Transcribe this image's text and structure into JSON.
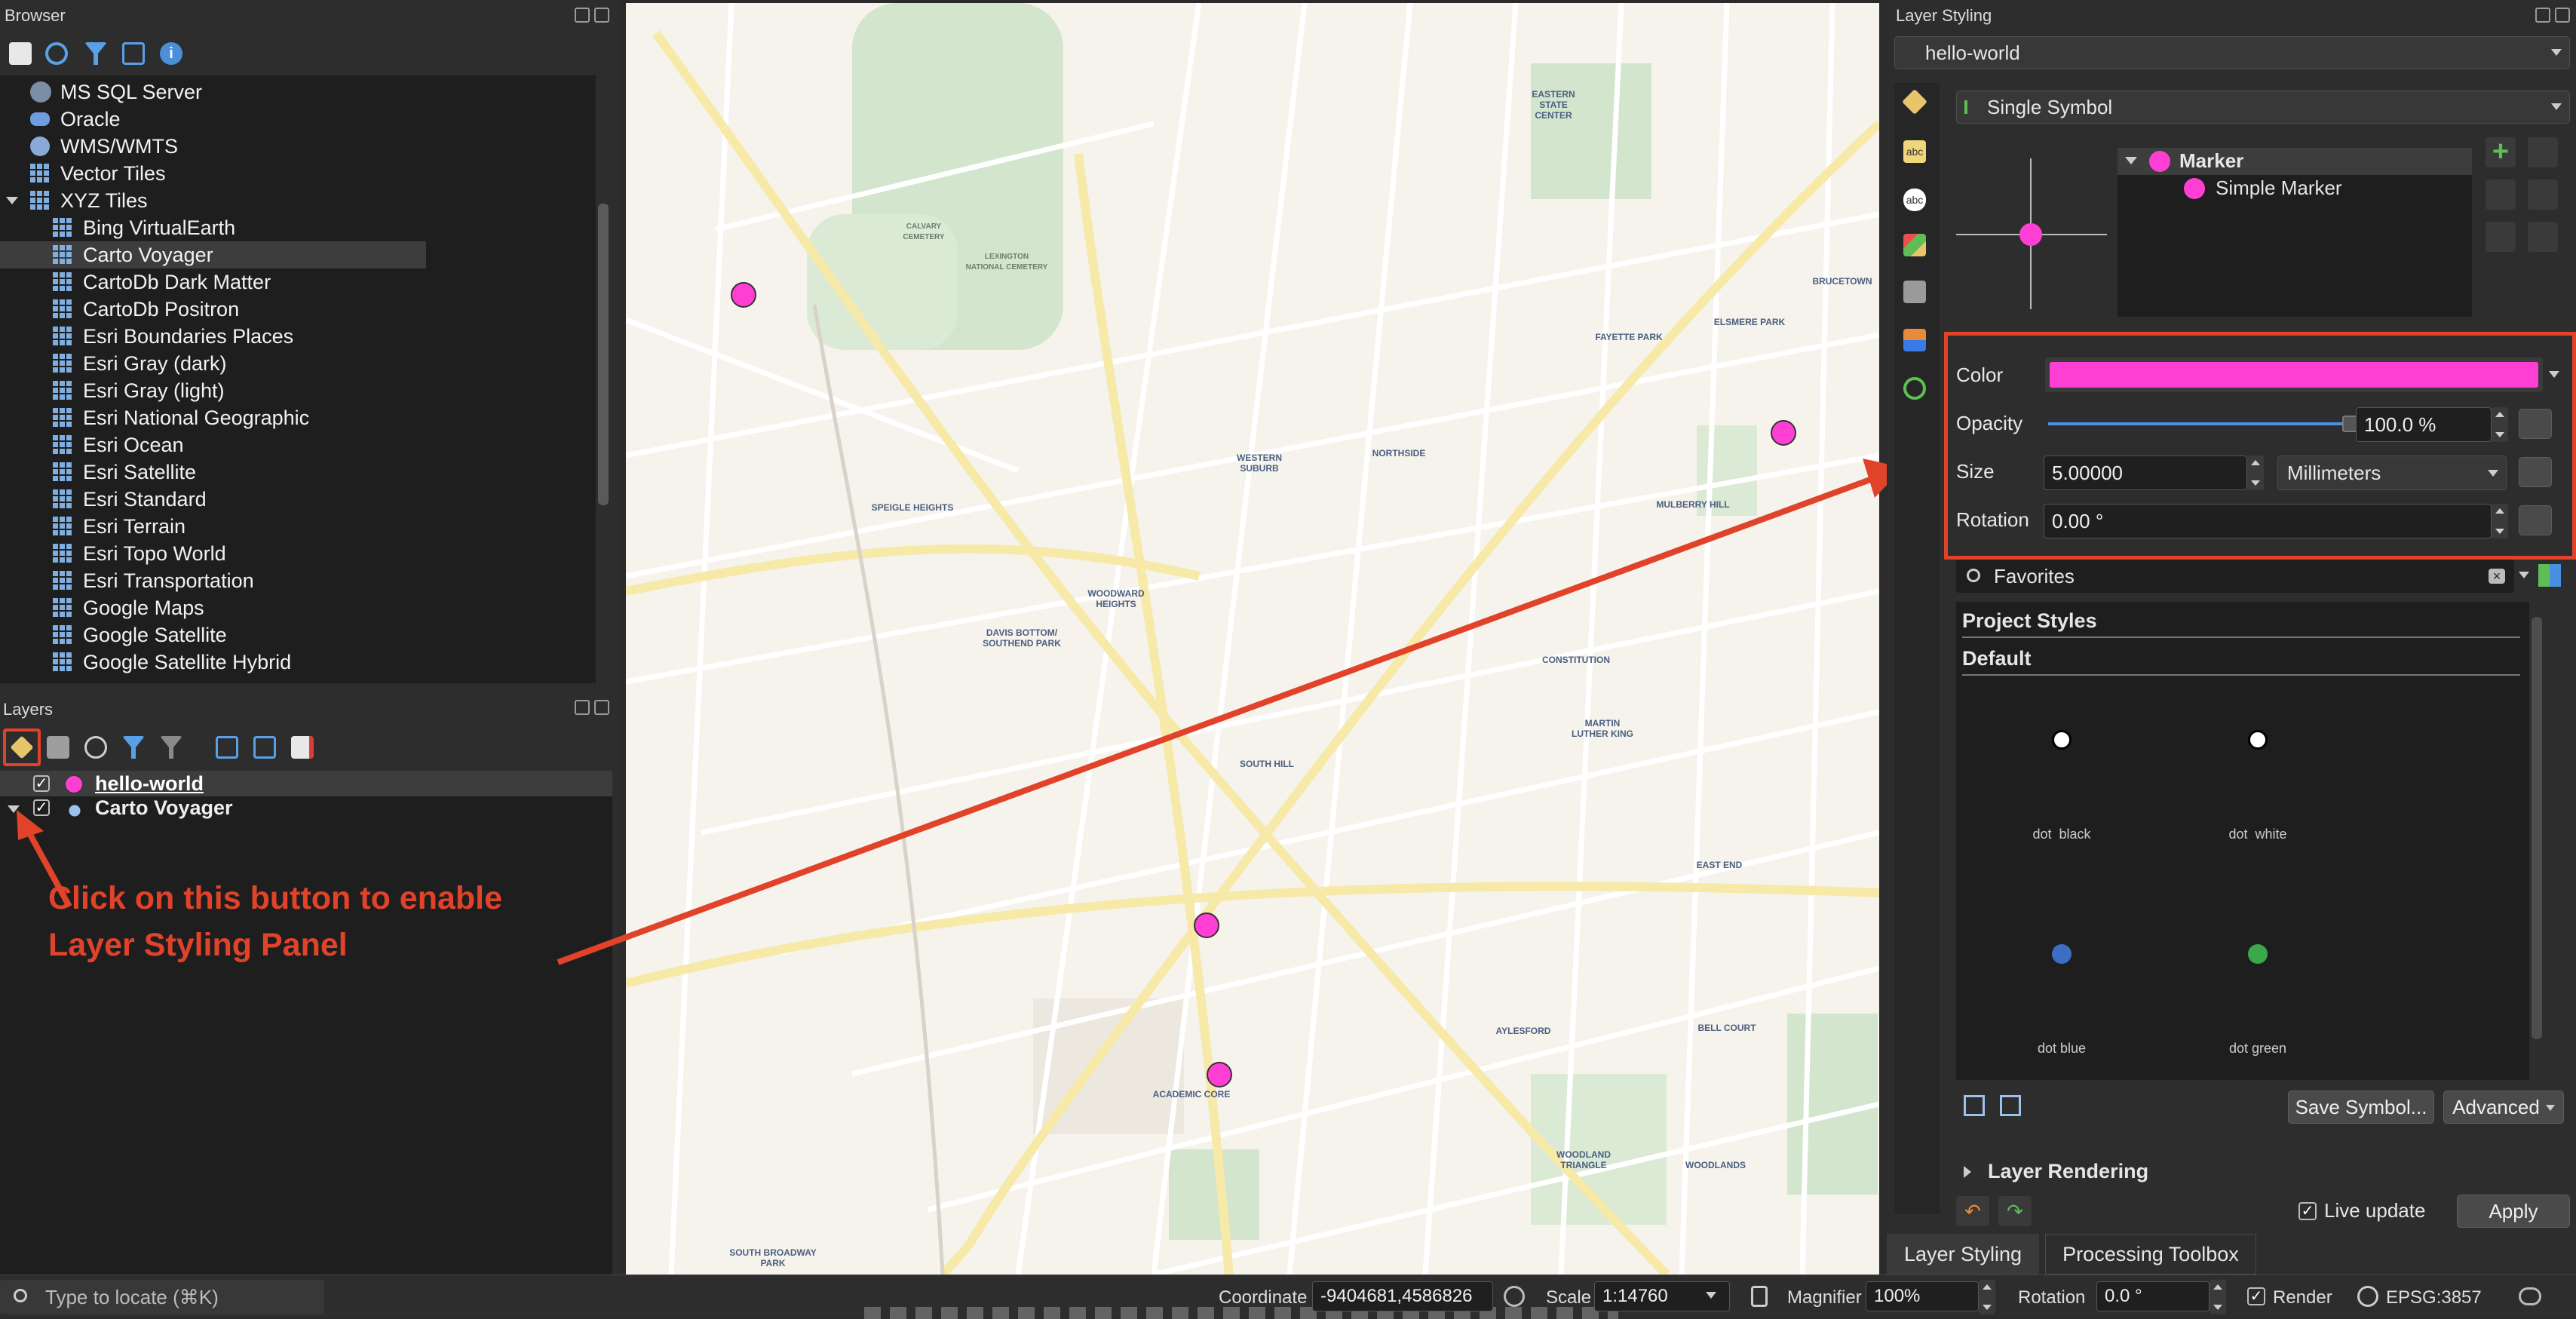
{
  "browser": {
    "title": "Browser",
    "items": [
      {
        "label": "MS SQL Server",
        "icon": "mssql-icon"
      },
      {
        "label": "Oracle",
        "icon": "oracle-icon"
      },
      {
        "label": "WMS/WMTS",
        "icon": "wms-icon"
      },
      {
        "label": "Vector Tiles",
        "icon": "tiles-icon"
      },
      {
        "label": "XYZ Tiles",
        "icon": "tiles-icon"
      },
      {
        "label": "Bing VirtualEarth",
        "icon": "tiles-icon"
      },
      {
        "label": "Carto Voyager",
        "icon": "tiles-icon"
      },
      {
        "label": "CartoDb Dark Matter",
        "icon": "tiles-icon"
      },
      {
        "label": "CartoDb Positron",
        "icon": "tiles-icon"
      },
      {
        "label": "Esri Boundaries Places",
        "icon": "tiles-icon"
      },
      {
        "label": "Esri Gray (dark)",
        "icon": "tiles-icon"
      },
      {
        "label": "Esri Gray (light)",
        "icon": "tiles-icon"
      },
      {
        "label": "Esri National Geographic",
        "icon": "tiles-icon"
      },
      {
        "label": "Esri Ocean",
        "icon": "tiles-icon"
      },
      {
        "label": "Esri Satellite",
        "icon": "tiles-icon"
      },
      {
        "label": "Esri Standard",
        "icon": "tiles-icon"
      },
      {
        "label": "Esri Terrain",
        "icon": "tiles-icon"
      },
      {
        "label": "Esri Topo World",
        "icon": "tiles-icon"
      },
      {
        "label": "Esri Transportation",
        "icon": "tiles-icon"
      },
      {
        "label": "Google Maps",
        "icon": "tiles-icon"
      },
      {
        "label": "Google Satellite",
        "icon": "tiles-icon"
      },
      {
        "label": "Google Satellite Hybrid",
        "icon": "tiles-icon"
      }
    ]
  },
  "layers": {
    "title": "Layers",
    "items": [
      {
        "label": "hello-world",
        "checked": true
      },
      {
        "label": "Carto Voyager",
        "checked": true
      }
    ]
  },
  "annotation": {
    "line1": "Click on this button to enable",
    "line2": "Layer Styling Panel",
    "color": "#e0432a"
  },
  "map": {
    "labels": [
      "EASTERN STATE CENTER",
      "WESTERN SUBURB",
      "NORTHSIDE",
      "FAYETTE PARK",
      "ELSMERE PARK",
      "MULBERRY HILL",
      "SPEIGLE HEIGHTS",
      "WOODWARD HEIGHTS",
      "DAVIS BOTTOM/ SOUTHEND PARK",
      "CONSTITUTION",
      "MARTIN LUTHER KING",
      "SOUTH HILL",
      "EAST END",
      "BELL COURT",
      "AYLESFORD",
      "ACADEMIC CORE",
      "WOODLAND TRIANGLE",
      "WOODLANDS",
      "SOUTH BROADWAY PARK",
      "LEXINGTON NATIONAL CEMETERY",
      "CALVARY CEMETERY",
      "BRUCETOWN"
    ]
  },
  "styling": {
    "title": "Layer Styling",
    "layer": "hello-world",
    "renderer": "Single Symbol",
    "tree": {
      "root": "Marker",
      "child": "Simple Marker"
    },
    "color_label": "Color",
    "color_value": "#ff3fd4",
    "opacity_label": "Opacity",
    "opacity_value": "100.0 %",
    "opacity_fraction": 1.0,
    "size_label": "Size",
    "size_value": "5.00000",
    "size_unit": "Millimeters",
    "rotation_label": "Rotation",
    "rotation_value": "0.00 °",
    "search_placeholder": "Favorites",
    "section1": "Project Styles",
    "section2": "Default",
    "symbols": [
      {
        "label": "dot  black",
        "color": "#ffffff"
      },
      {
        "label": "dot  white",
        "color": "#ffffff"
      },
      {
        "label": "dot blue",
        "color": "#3b6fc4"
      },
      {
        "label": "dot green",
        "color": "#3aa84a"
      }
    ],
    "save_symbol": "Save Symbol...",
    "advanced": "Advanced",
    "layer_rendering": "Layer Rendering",
    "live_update": "Live update",
    "apply": "Apply",
    "tabs": [
      "Layer Styling",
      "Processing Toolbox"
    ]
  },
  "status": {
    "locate_placeholder": "Type to locate (⌘K)",
    "coordinate_label": "Coordinate",
    "coordinate_value": "-9404681,4586826",
    "scale_label": "Scale",
    "scale_value": "1:14760",
    "magnifier_label": "Magnifier",
    "magnifier_value": "100%",
    "rotation_label": "Rotation",
    "rotation_value": "0.0 °",
    "render_label": "Render",
    "crs": "EPSG:3857"
  }
}
